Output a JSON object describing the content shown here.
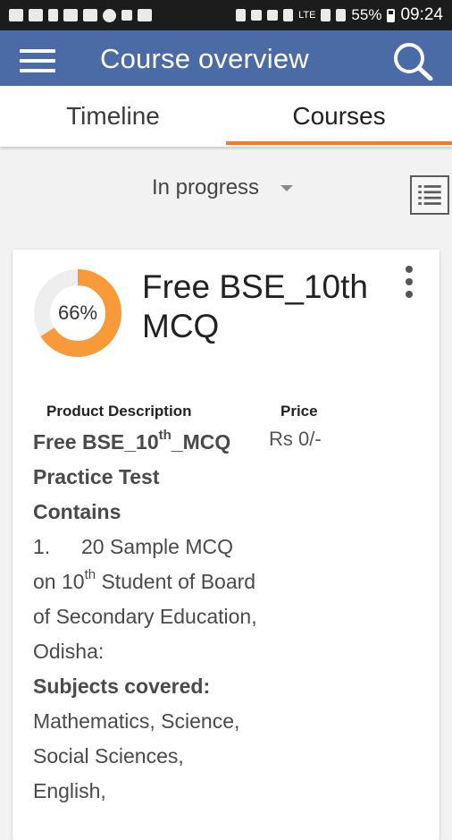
{
  "status_bar": {
    "battery": "55%",
    "network": "LTE",
    "time": "09:24"
  },
  "app_bar": {
    "title": "Course overview",
    "menu_icon": "hamburger-icon",
    "search_icon": "search-icon"
  },
  "tabs": [
    {
      "label": "Timeline",
      "selected": false
    },
    {
      "label": "Courses",
      "selected": true
    }
  ],
  "colors": {
    "app_bar": "#4a6ba6",
    "accent": "#f47b20",
    "progress_track": "#eeeeee"
  },
  "filter": {
    "selected": "In progress"
  },
  "course": {
    "progress_percent": 66,
    "progress_label": "66%",
    "title": "Free BSE_10th MCQ",
    "table": {
      "description_header": "Product Description",
      "price_header": "Price",
      "price": "Rs 0/-"
    },
    "description": {
      "line1_a": "Free BSE_10",
      "line1_sup": "th",
      "line1_b": "_MCQ",
      "line2": "Practice Test",
      "line3": "Contains",
      "item_number": "1.",
      "item_a": "20 Sample MCQ on 10",
      "item_sup": "th",
      "item_b": " Student of Board of Secondary Education, Odisha:",
      "subjects_heading": "Subjects covered:",
      "subjects": "Mathematics, Science, Social Sciences, English,"
    }
  }
}
